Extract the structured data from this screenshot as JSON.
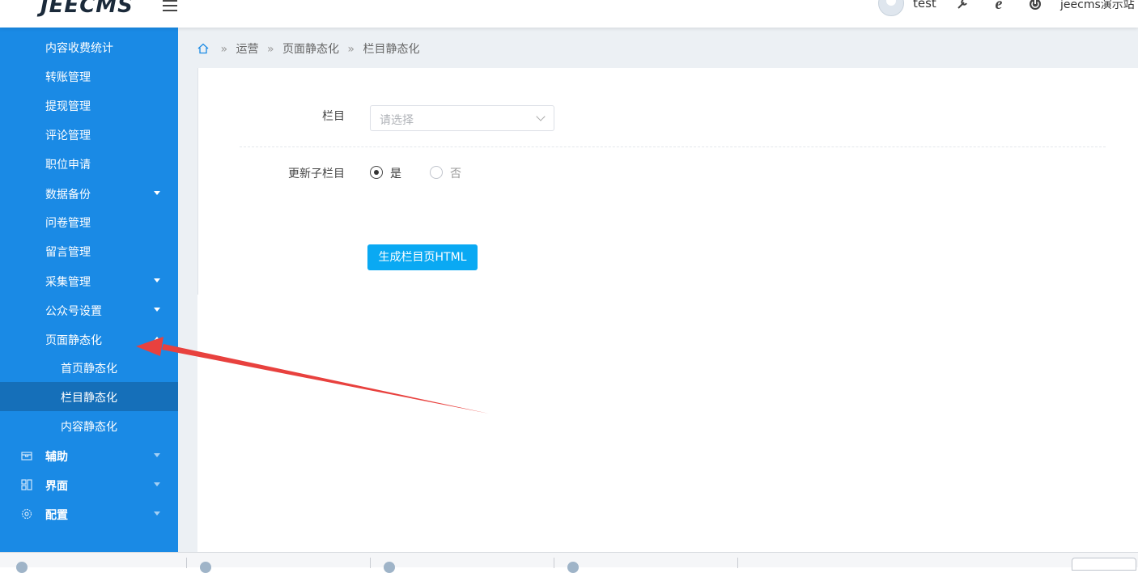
{
  "header": {
    "logo": "JEECMS",
    "username": "test",
    "site_name": "jeecms演示站",
    "site_caret": "˅"
  },
  "sidebar": {
    "items": [
      {
        "label": "内容收费统计"
      },
      {
        "label": "转账管理"
      },
      {
        "label": "提现管理"
      },
      {
        "label": "评论管理"
      },
      {
        "label": "职位申请"
      },
      {
        "label": "数据备份"
      },
      {
        "label": "问卷管理"
      },
      {
        "label": "留言管理"
      },
      {
        "label": "采集管理"
      },
      {
        "label": "公众号设置"
      },
      {
        "label": "页面静态化"
      },
      {
        "label": "首页静态化"
      },
      {
        "label": "栏目静态化"
      },
      {
        "label": "内容静态化"
      }
    ],
    "top_groups": [
      {
        "label": "辅助",
        "icon": "box-icon"
      },
      {
        "label": "界面",
        "icon": "layout-icon"
      },
      {
        "label": "配置",
        "icon": "gear-icon"
      }
    ]
  },
  "breadcrumb": {
    "items": [
      "运营",
      "页面静态化",
      "栏目静态化"
    ],
    "separator": "»"
  },
  "form": {
    "column_label": "栏目",
    "column_placeholder": "请选择",
    "update_children_label": "更新子栏目",
    "radio_yes": "是",
    "radio_no": "否",
    "selected": "是",
    "submit_label": "生成栏目页HTML"
  },
  "colors": {
    "sidebar": "#1a8ae5",
    "sidebar_active": "#156fb9",
    "button": "#0aa9f3",
    "annotation_arrow": "#e8413e"
  }
}
